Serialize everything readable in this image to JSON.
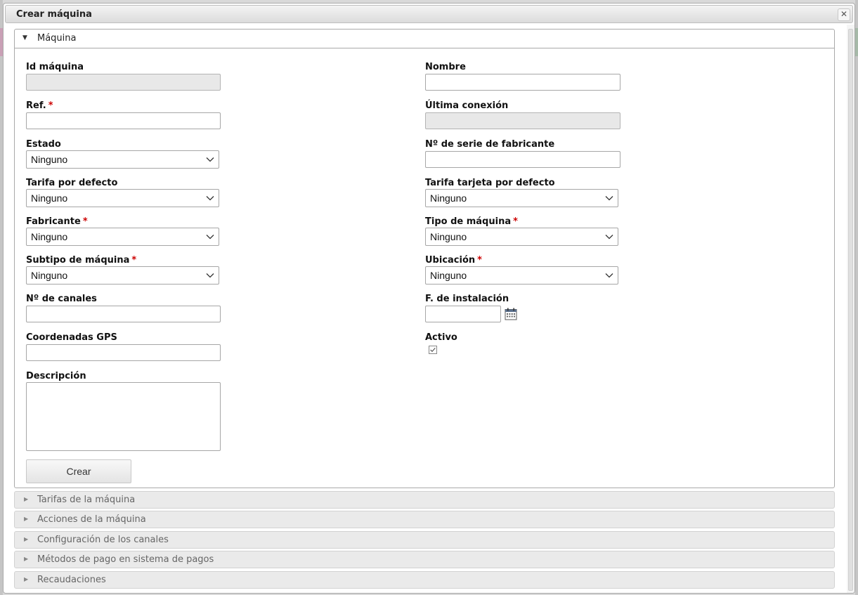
{
  "dialog": {
    "title": "Crear máquina",
    "close_symbol": "✕"
  },
  "panel": {
    "caret": "▼",
    "title": "Máquina"
  },
  "fields": {
    "id_maquina": {
      "label": "Id máquina",
      "value": ""
    },
    "nombre": {
      "label": "Nombre",
      "value": ""
    },
    "ref": {
      "label": "Ref.",
      "required": "*",
      "value": ""
    },
    "ultima_conexion": {
      "label": "Última conexión",
      "value": ""
    },
    "estado": {
      "label": "Estado",
      "value": "Ninguno"
    },
    "num_serie": {
      "label": "Nº de serie de fabricante",
      "value": ""
    },
    "tarifa_defecto": {
      "label": "Tarifa por defecto",
      "value": "Ninguno"
    },
    "tarifa_tarjeta": {
      "label": "Tarifa tarjeta por defecto",
      "value": "Ninguno"
    },
    "fabricante": {
      "label": "Fabricante",
      "required": "*",
      "value": "Ninguno"
    },
    "tipo_maquina": {
      "label": "Tipo de máquina",
      "required": "*",
      "value": "Ninguno"
    },
    "subtipo_maquina": {
      "label": "Subtipo de máquina",
      "required": "*",
      "value": "Ninguno"
    },
    "ubicacion": {
      "label": "Ubicación",
      "required": "*",
      "value": "Ninguno"
    },
    "num_canales": {
      "label": "Nº de canales",
      "value": ""
    },
    "fecha_instalacion": {
      "label": "F. de instalación",
      "value": ""
    },
    "coordenadas_gps": {
      "label": "Coordenadas GPS",
      "value": ""
    },
    "activo": {
      "label": "Activo",
      "checked": true
    },
    "descripcion": {
      "label": "Descripción",
      "value": ""
    }
  },
  "create_button": "Crear",
  "sections": [
    {
      "caret": "▶",
      "label": "Tarifas de la máquina"
    },
    {
      "caret": "▶",
      "label": "Acciones de la máquina"
    },
    {
      "caret": "▶",
      "label": "Configuración de los canales"
    },
    {
      "caret": "▶",
      "label": "Métodos de pago en sistema de pagos"
    },
    {
      "caret": "▶",
      "label": "Recaudaciones"
    }
  ],
  "icons": {
    "chevron": "chevron-down-icon",
    "calendar": "calendar-icon",
    "check": "checkmark-icon"
  },
  "colors": {
    "required": "#cc0000",
    "readonly_bg": "#e8e8e8",
    "section_bg": "#eaeaea"
  }
}
